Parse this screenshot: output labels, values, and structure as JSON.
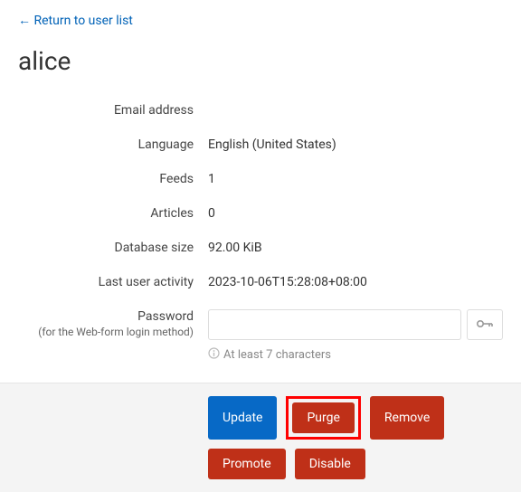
{
  "nav": {
    "return_link": "← Return to user list"
  },
  "page": {
    "title": "alice"
  },
  "fields": {
    "email": {
      "label": "Email address",
      "value": ""
    },
    "language": {
      "label": "Language",
      "value": "English (United States)"
    },
    "feeds": {
      "label": "Feeds",
      "value": "1"
    },
    "articles": {
      "label": "Articles",
      "value": "0"
    },
    "db_size": {
      "label": "Database size",
      "value": "92.00 KiB"
    },
    "last_activity": {
      "label": "Last user activity",
      "value": "2023-10-06T15:28:08+08:00"
    },
    "password": {
      "label": "Password",
      "sublabel": "(for the Web-form login method)",
      "value": "",
      "placeholder": "",
      "hint": "At least 7 characters"
    }
  },
  "actions": {
    "update": "Update",
    "purge": "Purge",
    "remove": "Remove",
    "promote": "Promote",
    "disable": "Disable"
  }
}
